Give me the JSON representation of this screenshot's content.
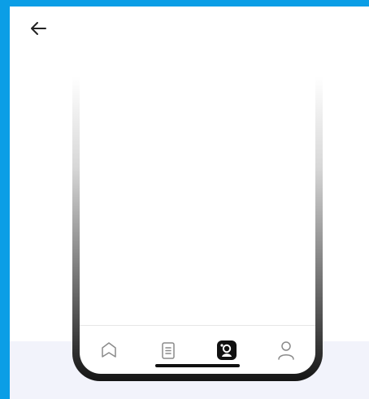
{
  "colors": {
    "frame_accent": "#0b9ee6",
    "page_background": "#ffffff",
    "bottom_band": "#f2f3fb",
    "active_tab": "#111111",
    "inactive_tab": "#8a8a8a"
  },
  "header": {
    "back_icon": "arrow-left-icon"
  },
  "tab_bar": {
    "items": [
      {
        "icon": "bookmark-home-icon",
        "active": false
      },
      {
        "icon": "document-list-icon",
        "active": false
      },
      {
        "icon": "app-logo-icon",
        "active": true
      },
      {
        "icon": "person-icon",
        "active": false
      }
    ]
  }
}
